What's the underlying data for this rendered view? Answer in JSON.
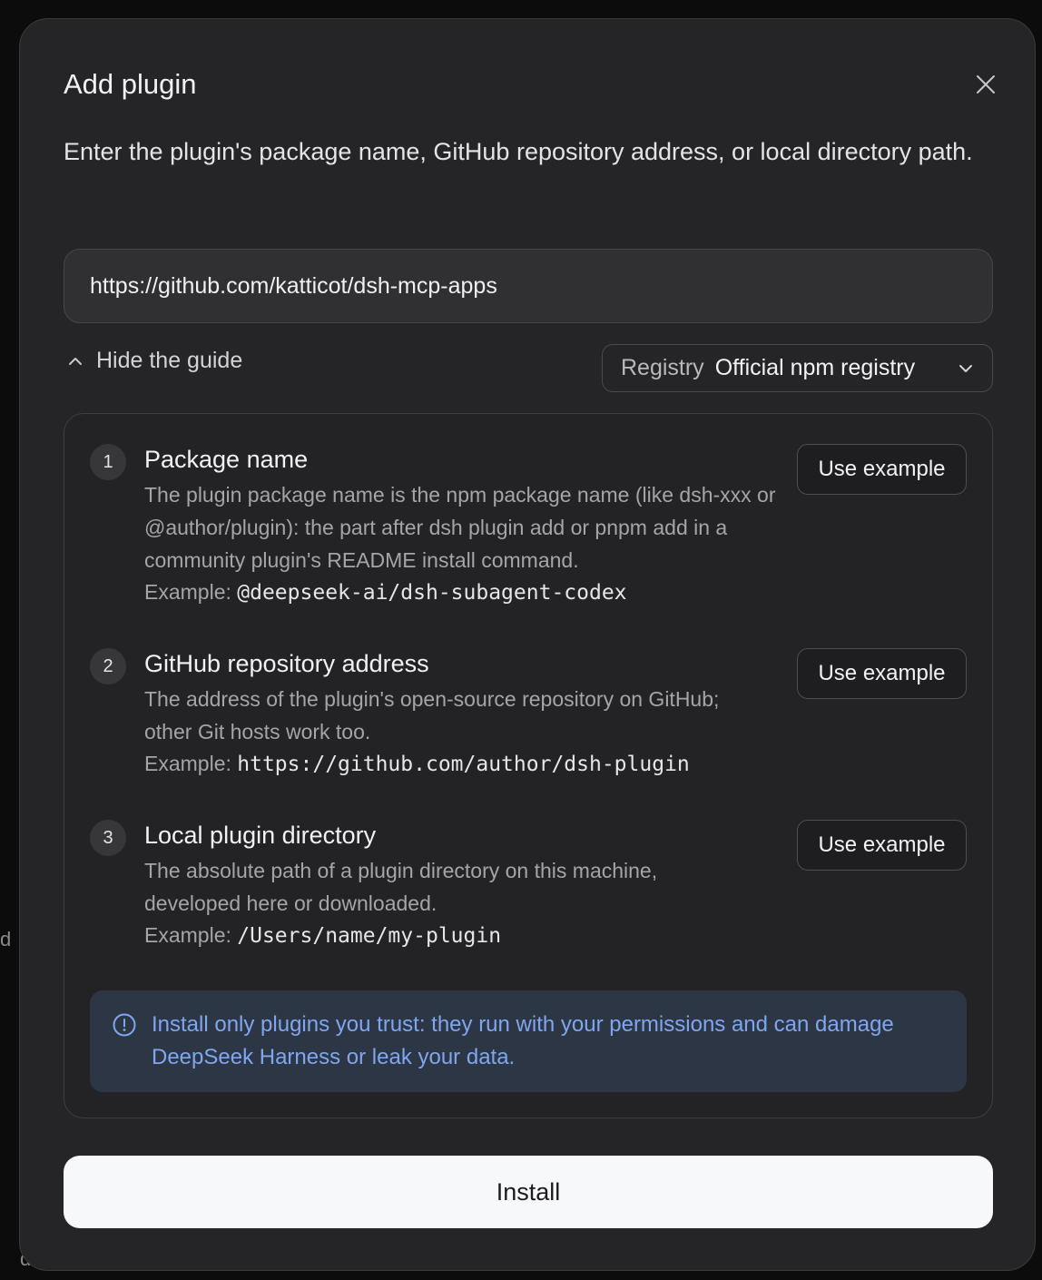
{
  "background": {
    "glyphs": [
      "d",
      "d"
    ]
  },
  "modal": {
    "title": "Add plugin",
    "description": "Enter the plugin's package name, GitHub repository address, or local directory path.",
    "input_value": "https://github.com/katticot/dsh-mcp-apps",
    "guide_toggle_label": "Hide the guide",
    "registry": {
      "label": "Registry",
      "value": "Official npm registry"
    },
    "steps": [
      {
        "number": "1",
        "title": "Package name",
        "body": "The plugin package name is the npm package name (like dsh-xxx or @author/plugin): the part after dsh plugin add or pnpm add in a community plugin's README install command.",
        "example_label": "Example:",
        "example_value": "@deepseek-ai/dsh-subagent-codex",
        "button": "Use example"
      },
      {
        "number": "2",
        "title": "GitHub repository address",
        "body": "The address of the plugin's open-source repository on GitHub; other Git hosts work too.",
        "example_label": "Example:",
        "example_value": "https://github.com/author/dsh-plugin",
        "button": "Use example"
      },
      {
        "number": "3",
        "title": "Local plugin directory",
        "body": "The absolute path of a plugin directory on this machine, developed here or downloaded.",
        "example_label": "Example:",
        "example_value": "/Users/name/my-plugin",
        "button": "Use example"
      }
    ],
    "warning": "Install only plugins you trust: they run with your permissions and can damage DeepSeek Harness or leak your data.",
    "install_label": "Install"
  },
  "icons": {
    "close": "close-icon",
    "toggle": "chevron-up-icon",
    "registry": "chevron-down-icon",
    "warning": "info-circle-icon"
  },
  "colors": {
    "modal_bg": "#252527",
    "warning_bg": "#2d3645",
    "warning_text": "#7fa6ee",
    "install_bg": "#f7f8fa"
  }
}
